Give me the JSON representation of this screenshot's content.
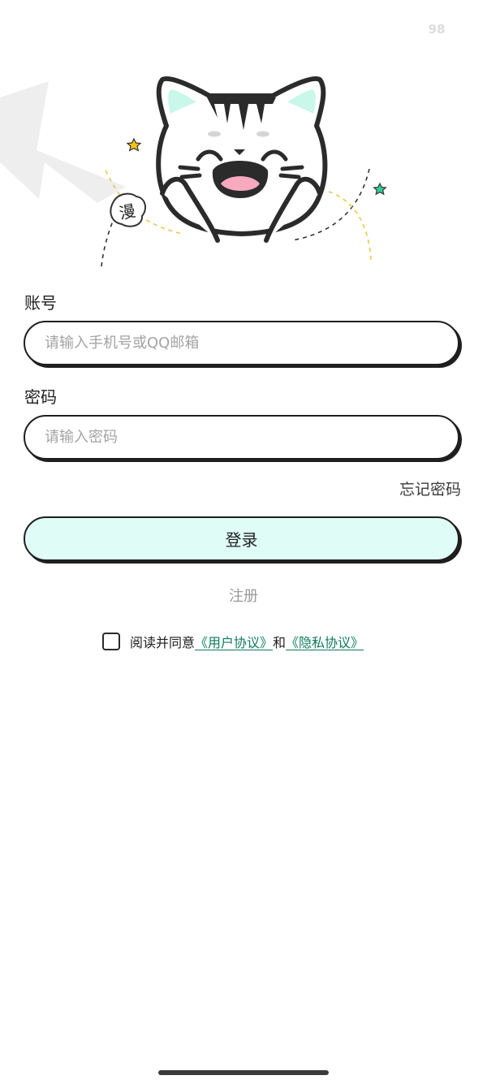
{
  "status_bar": {
    "number": "98"
  },
  "illustration": {
    "badge_text": "漫",
    "accent_color": "#c9f7ea",
    "star_yellow": "#f5c218",
    "star_green": "#2fcf9c"
  },
  "form": {
    "account_label": "账号",
    "account_placeholder": "请输入手机号或QQ邮箱",
    "password_label": "密码",
    "password_placeholder": "请输入密码",
    "forgot_label": "忘记密码",
    "login_label": "登录",
    "register_label": "注册"
  },
  "agreement": {
    "prefix": "阅读并同意",
    "user_agreement": "《用户协议》",
    "joiner": "和",
    "privacy_policy": "《隐私协议》",
    "checked": false
  },
  "colors": {
    "button_fill": "#dffdf6",
    "link": "#0f7a5c",
    "outline": "#1f1f1f"
  }
}
